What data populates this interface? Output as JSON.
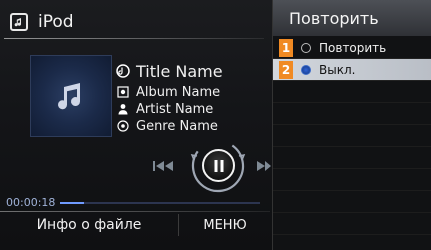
{
  "header": {
    "title": "iPod",
    "icon": "ipod-note-icon"
  },
  "track": {
    "title": "Title Name",
    "album": "Album Name",
    "artist": "Artist Name",
    "genre": "Genre Name"
  },
  "playback": {
    "time": "00:00:18",
    "progress": 0.12,
    "state": "paused"
  },
  "footer": {
    "info_label": "Инфо о файле",
    "menu_label": "МЕНЮ"
  },
  "repeat_menu": {
    "title": "Повторить",
    "items": [
      {
        "num": "1",
        "label": "Повторить",
        "selected": false
      },
      {
        "num": "2",
        "label": "Выкл.",
        "selected": true
      }
    ]
  },
  "colors": {
    "accent": "#f08a23",
    "highlight": "#c6ccd3",
    "progress": "#6f9bff"
  }
}
